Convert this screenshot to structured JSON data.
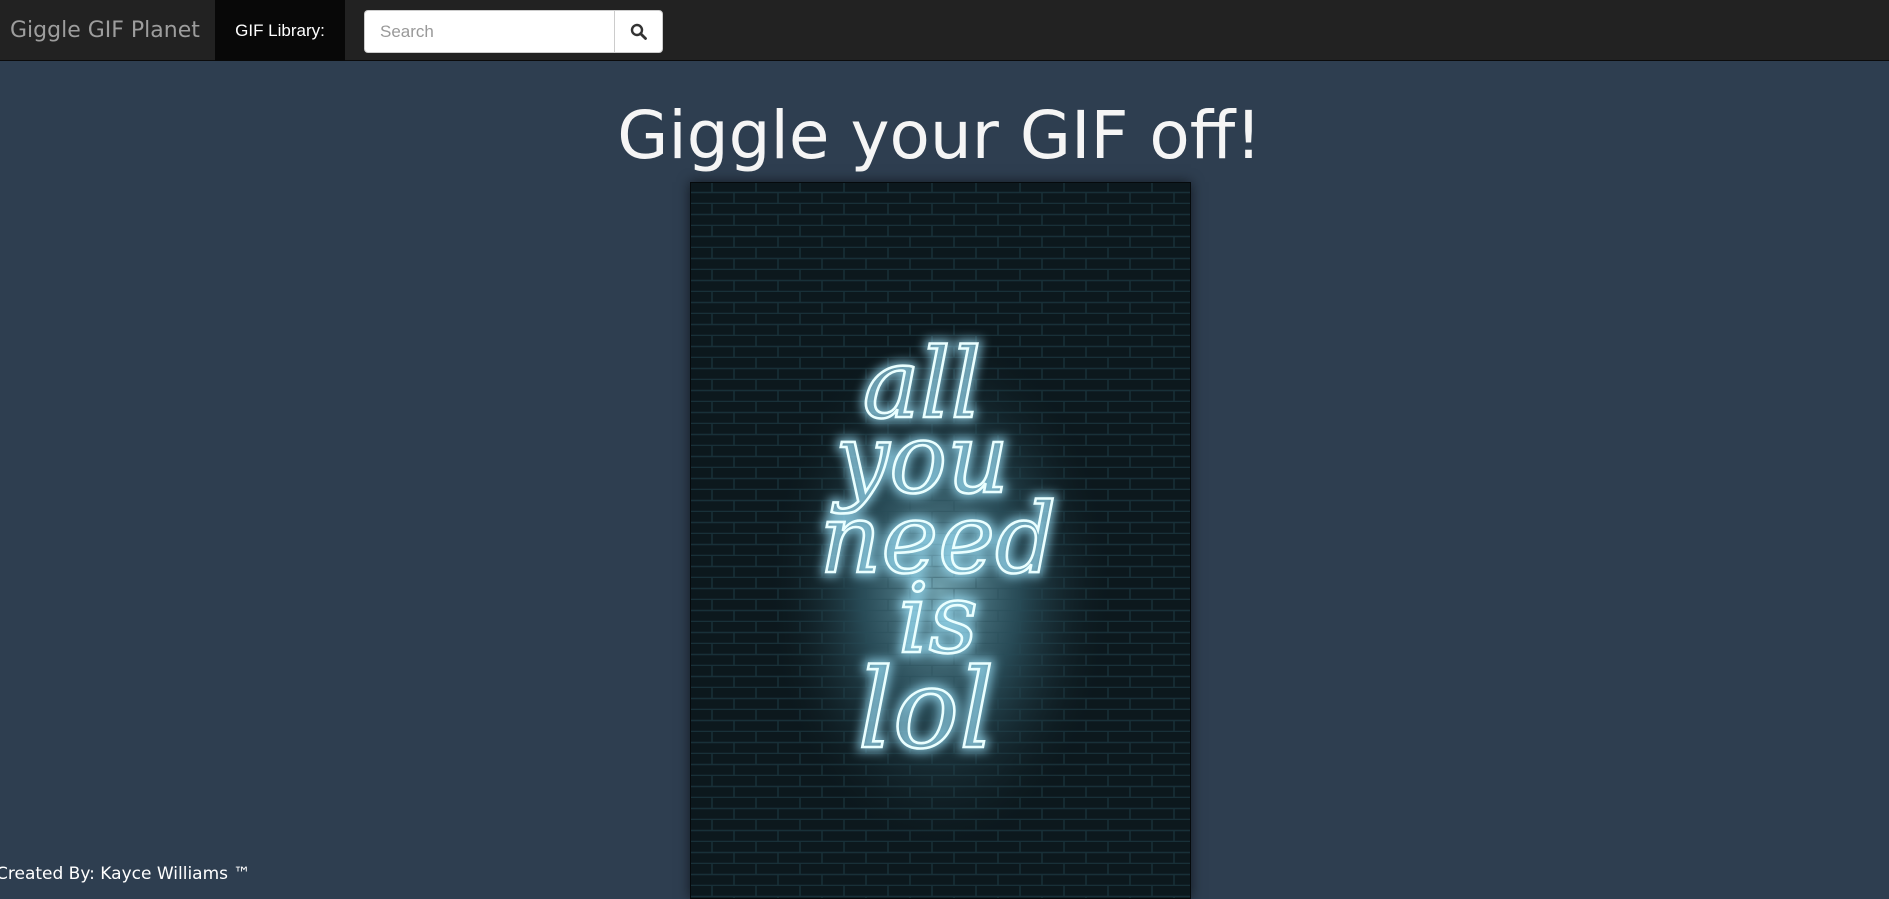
{
  "navbar": {
    "brand": "Giggle GIF Planet",
    "active_item": "GIF Library:",
    "search": {
      "placeholder": "Search",
      "value": "",
      "button_icon": "search-icon"
    }
  },
  "main": {
    "headline": "Giggle your GIF off!",
    "image": {
      "neon_text": [
        "all",
        "you",
        "need",
        "is",
        "lol"
      ]
    }
  },
  "footer": {
    "credit": "Created By: Kayce Williams ™"
  },
  "colors": {
    "background": "#2e3e50",
    "navbar": "#222222",
    "nav_active": "#080808",
    "neon": "#bfefff"
  }
}
